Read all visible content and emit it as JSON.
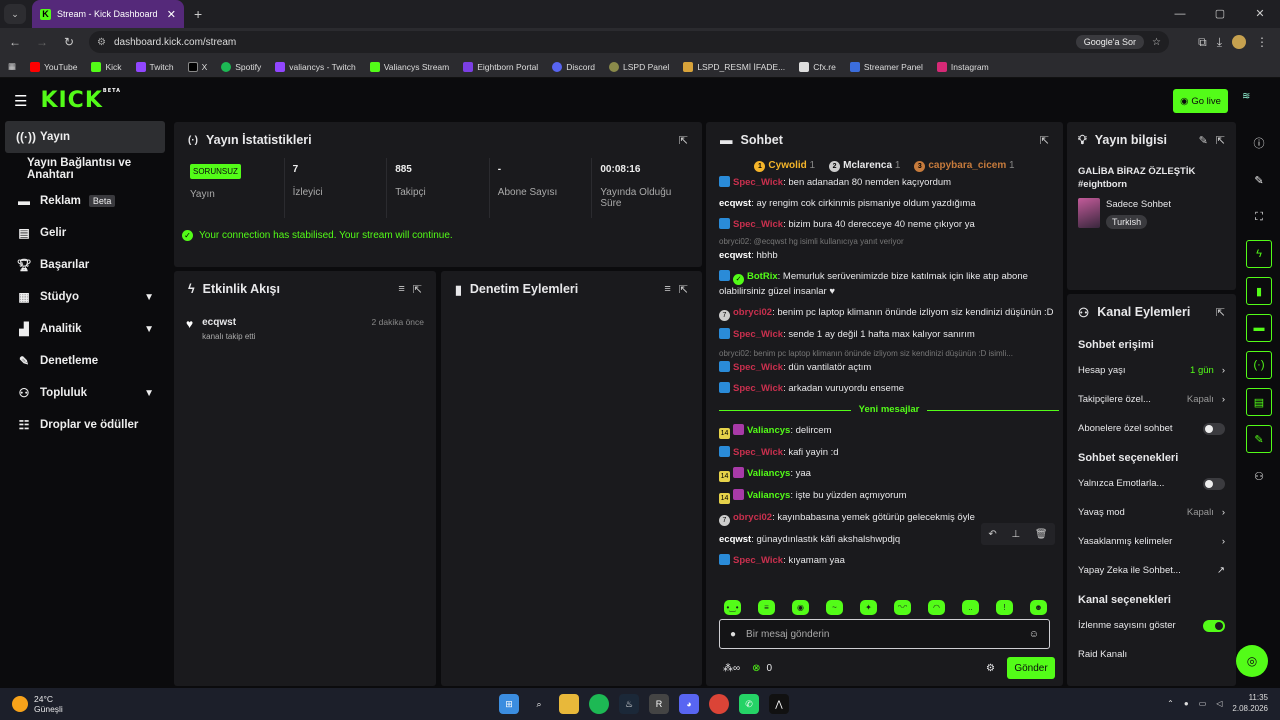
{
  "browser": {
    "tab_title": "Stream - Kick Dashboard",
    "url": "dashboard.kick.com/stream",
    "google_pill": "Google'a Sor"
  },
  "bookmarks": [
    "YouTube",
    "Kick",
    "Twitch",
    "X",
    "Spotify",
    "valiancys - Twitch",
    "Valiancys Stream",
    "Eightborn Portal",
    "Discord",
    "LSPD Panel",
    "LSPD_RESMİ İFADE...",
    "Cfx.re",
    "Streamer Panel",
    "Instagram"
  ],
  "kick": {
    "logo": "KICK",
    "logo_sup": "BETA",
    "go_live": "Go live"
  },
  "sidebar": [
    {
      "label": "Yayın"
    },
    {
      "label": "Yayın Bağlantısı ve Anahtarı"
    },
    {
      "label": "Reklam",
      "badge": "Beta"
    },
    {
      "label": "Gelir"
    },
    {
      "label": "Başarılar"
    },
    {
      "label": "Stüdyo"
    },
    {
      "label": "Analitik"
    },
    {
      "label": "Denetleme"
    },
    {
      "label": "Topluluk"
    },
    {
      "label": "Droplar ve ödüller"
    }
  ],
  "stats": {
    "title": "Yayın İstatistikleri",
    "status": "SORUNSUZ",
    "status_label": "Yayın",
    "items": [
      {
        "value": "7",
        "label": "İzleyici"
      },
      {
        "value": "885",
        "label": "Takipçi"
      },
      {
        "value": "-",
        "label": "Abone Sayısı"
      },
      {
        "value": "00:08:16",
        "label": "Yayında Olduğu Süre"
      }
    ],
    "notice": "Your connection has stabilised. Your stream will continue."
  },
  "activity": {
    "title": "Etkinlik Akışı",
    "user": "ecqwst",
    "action": "kanalı takip etti",
    "time": "2 dakika önce"
  },
  "moderation": {
    "title": "Denetim Eylemleri"
  },
  "chat": {
    "title": "Sohbet",
    "top": [
      {
        "name": "Cywolid",
        "n": "1",
        "rank": "1"
      },
      {
        "name": "Mclarenca",
        "n": "1",
        "rank": "2"
      },
      {
        "name": "capybara_cicem",
        "n": "1",
        "rank": "3"
      }
    ],
    "messages": [
      {
        "user": "Spec_Wick",
        "text": "ben adanadan 80 nemden kaçıyordum"
      },
      {
        "user": "ecqwst",
        "text": "ay rengim cok cirkinmis pismaniye oldum yazdığıma"
      },
      {
        "user": "Spec_Wick",
        "text": "bizim bura 40 derecceye 40 neme çıkıyor ya"
      },
      {
        "reply": "obryci02: @ecqwst hg isimli kullanıcıya yanıt veriyor"
      },
      {
        "user": "ecqwst",
        "text": "hbhb"
      },
      {
        "user": "BotRix",
        "text": "Memurluk serüvenimizde bize katılmak için like atıp abone olabilirsiniz güzel insanlar ♥"
      },
      {
        "user": "obryci02",
        "text": "benim pc laptop klimanın önünde izliyom siz kendinizi düşünün :D"
      },
      {
        "user": "Spec_Wick",
        "text": "sende 1 ay değil 1 hafta max kalıyor sanırım"
      },
      {
        "reply": "obryci02: benim pc laptop klimanın önünde izliyom siz kendinizi düşünün :D isimli..."
      },
      {
        "user": "Spec_Wick",
        "text": "dün vantilatör açtım"
      },
      {
        "user": "Spec_Wick",
        "text": "arkadan vuruyordu enseme"
      }
    ],
    "new_label": "Yeni mesajlar",
    "new_messages": [
      {
        "user": "Valiancys",
        "text": "delircem"
      },
      {
        "user": "Spec_Wick",
        "text": "kafi yayin :d"
      },
      {
        "user": "Valiancys",
        "text": "yaa"
      },
      {
        "user": "Valiancys",
        "text": "işte bu yüzden açmıyorum"
      },
      {
        "user": "obryci02",
        "text": "kayınbabasına yemek götürüp gelecekmiş öyle"
      },
      {
        "user": "ecqwst",
        "text": "günaydınlastık kâfi akshalshwpdjq"
      },
      {
        "user": "Spec_Wick",
        "text": "kıyamam yaa"
      }
    ],
    "placeholder": "Bir mesaj gönderin",
    "points": "0",
    "send": "Gönder",
    "badge_sub": "14"
  },
  "info": {
    "title": "Yayın bilgisi",
    "stream_title": "GALİBA BİRAZ ÖZLEŞTİK #eightborn",
    "category": "Sadece Sohbet",
    "tag": "Turkish"
  },
  "channel": {
    "title": "Kanal Eylemleri",
    "chat_access": "Sohbet erişimi",
    "account_age": "Hesap yaşı",
    "account_age_val": "1 gün",
    "followers_only": "Takipçilere özel...",
    "followers_val": "Kapalı",
    "subs_only": "Abonelere özel sohbet",
    "chat_options": "Sohbet seçenekleri",
    "emotes_only": "Yalnızca Emotlarla...",
    "slow_mode": "Yavaş mod",
    "slow_val": "Kapalı",
    "banned_words": "Yasaklanmış kelimeler",
    "ai": "Yapay Zeka ile Sohbet...",
    "channel_options": "Kanal seçenekleri",
    "show_views": "İzlenme sayısını göster",
    "raid": "Raid Kanalı"
  },
  "taskbar": {
    "temp": "24°C",
    "weather": "Güneşli",
    "time": "11:35",
    "date": "2.08.2026"
  }
}
